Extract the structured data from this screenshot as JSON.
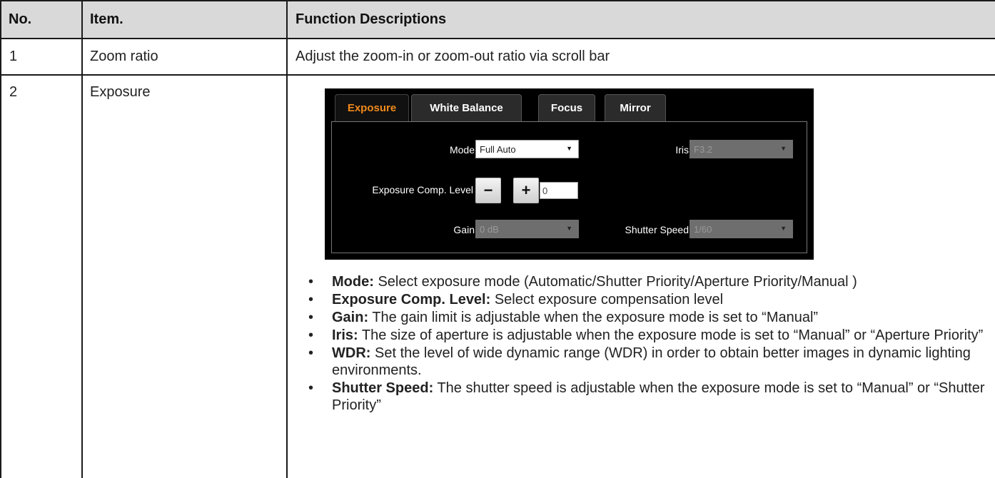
{
  "table": {
    "headers": {
      "no": "No.",
      "item": "Item.",
      "desc": "Function Descriptions"
    },
    "rows": [
      {
        "no": "1",
        "item": "Zoom ratio",
        "desc": "Adjust the zoom-in or zoom-out ratio via scroll bar"
      },
      {
        "no": "2",
        "item": "Exposure"
      }
    ]
  },
  "panel": {
    "tabs": [
      {
        "label": "Exposure",
        "active": true
      },
      {
        "label": "White Balance",
        "active": false
      },
      {
        "label": "Focus",
        "active": false
      },
      {
        "label": "Mirror",
        "active": false
      }
    ],
    "mode": {
      "label": "Mode",
      "value": "Full Auto"
    },
    "iris": {
      "label": "Iris",
      "value": "F3.2"
    },
    "exposure_comp": {
      "label": "Exposure Comp. Level",
      "minus": "−",
      "plus": "+",
      "value": "0"
    },
    "gain": {
      "label": "Gain",
      "value": "0 dB"
    },
    "shutter": {
      "label": "Shutter Speed",
      "value": "1/60"
    },
    "dropdown_arrow": "▼",
    "colors": {
      "active_tab": "#f08a1c",
      "panel_bg": "#000000",
      "disabled_field": "#6e6e6e"
    }
  },
  "bullets": [
    {
      "term": "Mode:",
      "text": " Select exposure mode (Automatic/Shutter Priority/Aperture Priority/Manual )"
    },
    {
      "term": "Exposure Comp. Level:",
      "text": " Select exposure compensation level"
    },
    {
      "term": "Gain:",
      "text": " The gain limit is adjustable when the exposure mode is set to “Manual”"
    },
    {
      "term": "Iris:",
      "text": " The size of aperture is adjustable when the exposure mode is set to “Manual” or “Aperture Priority”"
    },
    {
      "term": "WDR:",
      "text": " Set the level of wide dynamic range (WDR) in order to obtain better images in dynamic lighting environments."
    },
    {
      "term": "Shutter Speed:",
      "text": " The shutter speed is adjustable when the exposure mode is set to “Manual” or “Shutter Priority”"
    }
  ],
  "bullet_glyph": "•",
  "header_bg": "#d9d9d9"
}
